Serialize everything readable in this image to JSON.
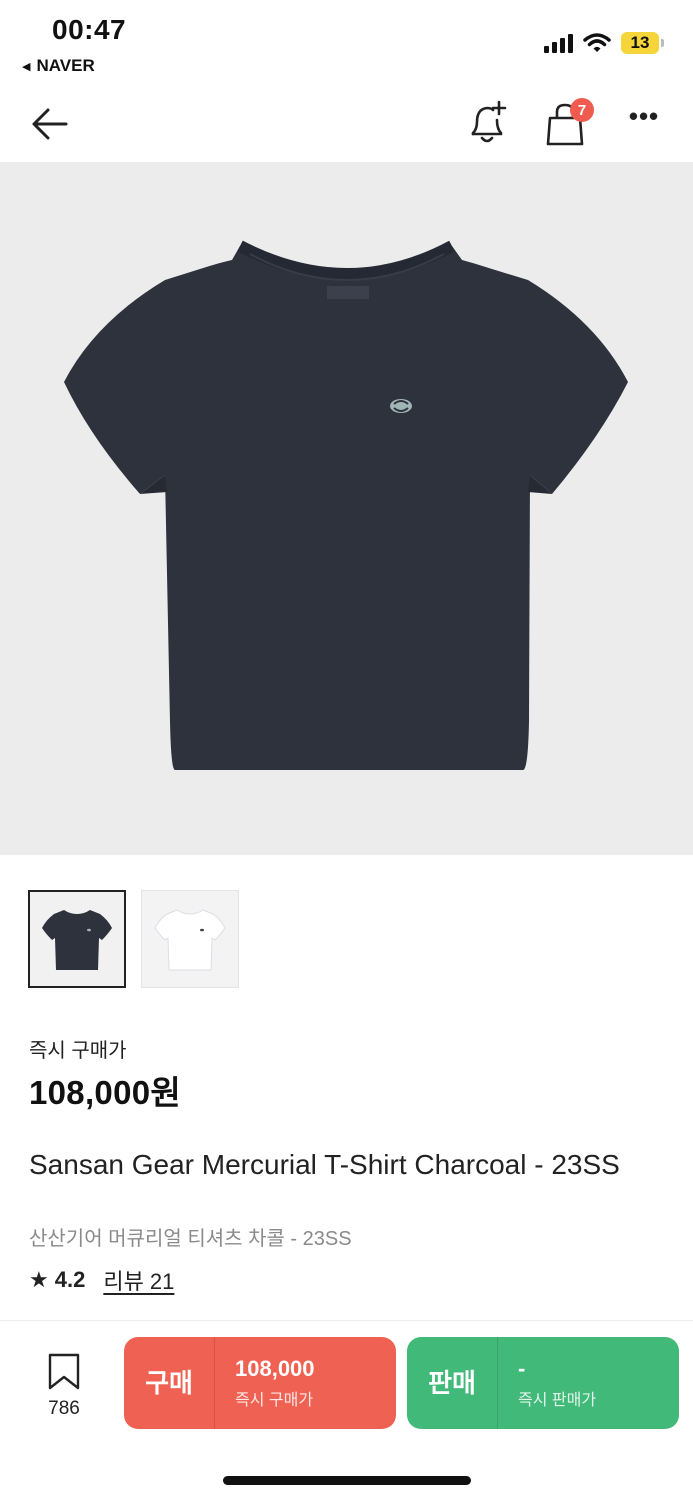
{
  "status_bar": {
    "time": "00:47",
    "back_app": "NAVER",
    "battery": "13"
  },
  "nav": {
    "cart_badge": "7",
    "more": "•••"
  },
  "product": {
    "instant_buy_label": "즉시 구매가",
    "price": "108,000원",
    "title_en": "Sansan Gear Mercurial T-Shirt Charcoal - 23SS",
    "title_ko": "산산기어 머큐리얼 티셔츠 차콜 - 23SS",
    "rating": "4.2",
    "review_link": "리뷰 21",
    "thumbnails": [
      "charcoal",
      "white"
    ],
    "colors": {
      "charcoal": "#2e323d",
      "white": "#f7f7fa"
    }
  },
  "bottom": {
    "bookmark_count": "786",
    "buy": {
      "label": "구매",
      "price": "108,000",
      "sub": "즉시 구매가",
      "color": "#ef6253"
    },
    "sell": {
      "label": "판매",
      "price": "-",
      "sub": "즉시 판매가",
      "color": "#41b979"
    }
  }
}
